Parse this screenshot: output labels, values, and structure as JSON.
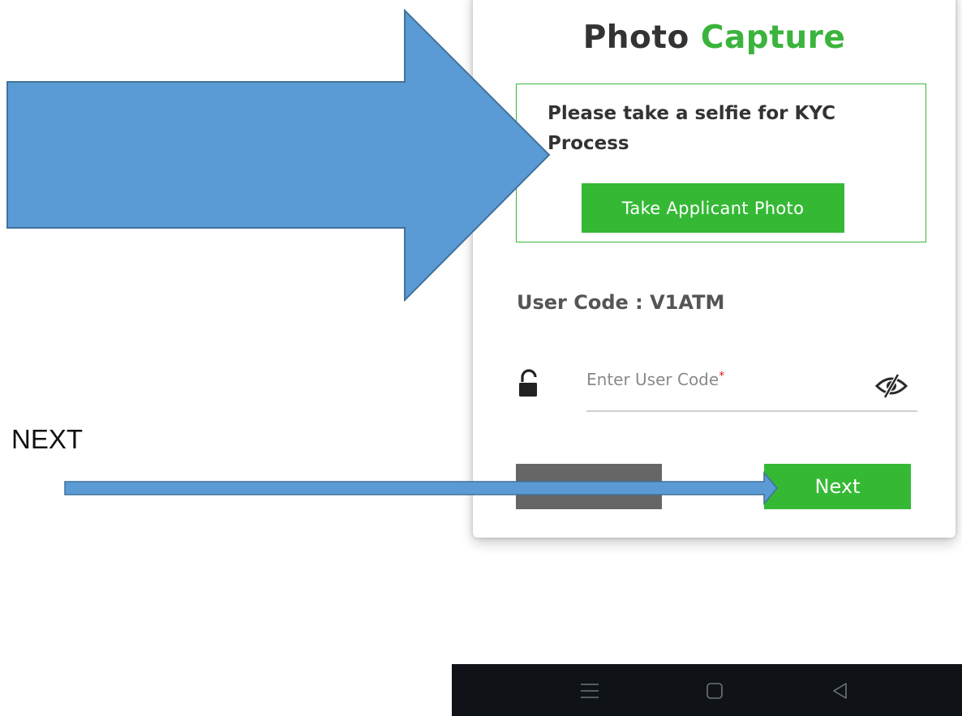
{
  "card": {
    "title_prefix": "Photo",
    "title_accent": "Capture",
    "selfie_prompt": "Please take a selfie for KYC Process",
    "take_photo_label": "Take Applicant Photo",
    "user_code_text": "User Code : V1ATM",
    "user_code_input": {
      "placeholder": "Enter User Code",
      "required_mark": "*",
      "value": ""
    },
    "previous_label": "",
    "next_label": "Next"
  },
  "annotation": {
    "next_label": "NEXT"
  },
  "icons": {
    "lock": "unlock-icon",
    "eye": "eye-slash-icon",
    "nav_menu": "menu-icon",
    "nav_home": "home-icon",
    "nav_back": "back-icon"
  },
  "colors": {
    "accent_green": "#3bb43d",
    "button_green": "#35b935",
    "arrow_blue": "#5b9bd5",
    "navbar": "#0f1317"
  }
}
